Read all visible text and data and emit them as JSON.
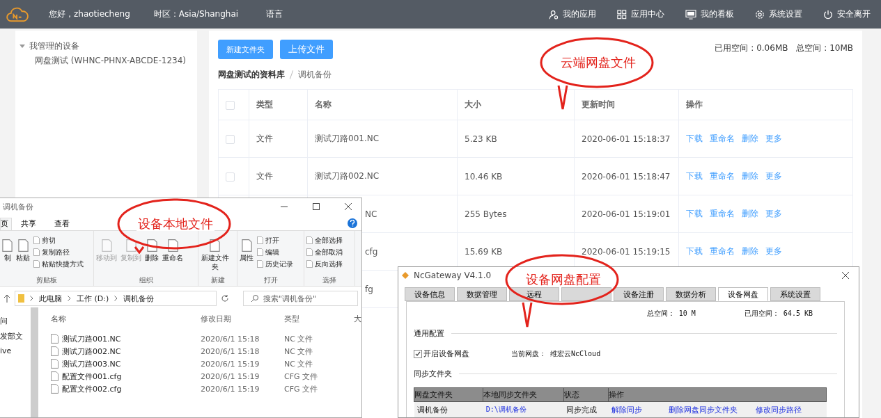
{
  "header": {
    "greeting": "您好，zhaotiecheng",
    "timezone": "时区：Asia/Shanghai",
    "language": "语言",
    "nav": [
      {
        "label": "我的应用",
        "kind": "user"
      },
      {
        "label": "应用中心",
        "kind": "apps"
      },
      {
        "label": "我的看板",
        "kind": "monitor"
      },
      {
        "label": "系统设置",
        "kind": "gear"
      },
      {
        "label": "安全离开",
        "kind": "power"
      }
    ]
  },
  "sidebar": {
    "items": [
      {
        "label": "我管理的设备",
        "expanded": true,
        "children": [
          {
            "label": "网盘测试 (WHNC-PHNX-ABCDE-1234)"
          }
        ]
      }
    ]
  },
  "buttons": [
    "新建文件夹",
    "上传文件"
  ],
  "storage": {
    "used": "已用空间 : 0.06MB",
    "total": "总空间 : 10MB"
  },
  "breadcrumb": [
    "网盘测试的资料库",
    "调机备份"
  ],
  "table": {
    "header_checked": false,
    "columns": [
      "类型",
      "名称",
      "大小",
      "更新时间",
      "操作"
    ],
    "rows": [
      {
        "checked": false,
        "type": "文件",
        "name": "测试刀路001.NC",
        "size": "5.23 KB",
        "time": "2020-06-01 15:18:37",
        "actions": [
          "下载",
          "重命名",
          "删除",
          "更多"
        ]
      },
      {
        "checked": false,
        "type": "文件",
        "name": "测试刀路002.NC",
        "size": "10.46 KB",
        "time": "2020-06-01 15:18:47",
        "actions": [
          "下载",
          "重命名",
          "删除",
          "更多"
        ]
      },
      {
        "name": "NC",
        "size": "255 Bytes",
        "time": "2020-06-01 15:19:01",
        "actions": [
          "下载",
          "重命名",
          "删除",
          "更多"
        ]
      },
      {
        "name": "cfg",
        "size": "15.69 KB",
        "time": "2020-06-01 15:19:15",
        "actions": [
          "下载",
          "重命名",
          "删除",
          "更多"
        ]
      },
      {
        "name": "fg"
      }
    ]
  },
  "explorer": {
    "title": "调机备份",
    "tabs": [
      {
        "label": "页",
        "selected": true
      },
      {
        "label": "共享",
        "selected": false
      },
      {
        "label": "查看",
        "selected": false
      }
    ],
    "groups": [
      {
        "label": "剪贴板",
        "items": [
          {
            "kind": "large",
            "label": "制",
            "disabled": false
          },
          {
            "kind": "large",
            "label": "粘贴",
            "disabled": false
          },
          {
            "kind": "small",
            "label": "剪切"
          },
          {
            "kind": "small",
            "label": "复制路径"
          },
          {
            "kind": "small",
            "label": "粘贴快捷方式"
          }
        ]
      },
      {
        "label": "组织",
        "items": [
          {
            "kind": "large",
            "label": "移动到",
            "disabled": true
          },
          {
            "kind": "large",
            "label": "复制到",
            "disabled": true
          },
          {
            "kind": "large",
            "label": "删除",
            "disabled": false
          },
          {
            "kind": "large",
            "label": "重命名",
            "disabled": false
          }
        ]
      },
      {
        "label": "新建",
        "items": [
          {
            "kind": "large",
            "label": "新建文件夹",
            "disabled": false
          }
        ]
      },
      {
        "label": "打开",
        "items": [
          {
            "kind": "large",
            "label": "属性",
            "disabled": false
          },
          {
            "kind": "small",
            "label": "打开"
          },
          {
            "kind": "small",
            "label": "编辑"
          },
          {
            "kind": "small",
            "label": "历史记录"
          }
        ]
      },
      {
        "label": "选择",
        "items": [
          {
            "kind": "small",
            "label": "全部选择"
          },
          {
            "kind": "small",
            "label": "全部取消"
          },
          {
            "kind": "small",
            "label": "反向选择"
          }
        ]
      }
    ],
    "address": [
      "此电脑",
      "工作 (D:)",
      "调机备份"
    ],
    "search": {
      "placeholder": "搜索\"调机备份\""
    },
    "nav": [
      "问",
      "发部文",
      "ive"
    ],
    "columns": [
      "名称",
      "修改日期",
      "类型",
      "大"
    ],
    "files": [
      {
        "name": "测试刀路001.NC",
        "date": "2020/6/1 15:18",
        "type": "NC 文件"
      },
      {
        "name": "测试刀路002.NC",
        "date": "2020/6/1 15:18",
        "type": "NC 文件"
      },
      {
        "name": "测试刀路003.NC",
        "date": "2020/6/1 15:19",
        "type": "NC 文件"
      },
      {
        "name": "配置文件001.cfg",
        "date": "2020/6/1 15:19",
        "type": "CFG 文件"
      },
      {
        "name": "配置文件002.cfg",
        "date": "2020/6/1 15:19",
        "type": "CFG 文件"
      }
    ]
  },
  "gateway": {
    "title": "NcGateway V4.1.0",
    "tabs": [
      {
        "label": "设备信息",
        "selected": false
      },
      {
        "label": "数据管理",
        "selected": false
      },
      {
        "label": "远程",
        "selected": false
      },
      {
        "selected": false
      },
      {
        "label": "设备注册",
        "selected": false
      },
      {
        "label": "数据分析",
        "selected": false
      },
      {
        "label": "设备网盘",
        "selected": true
      },
      {
        "label": "系统设置",
        "selected": false
      }
    ],
    "total": "总空间： 10 M",
    "used": "已用空间： 64.5 KB",
    "general": "通用配置",
    "enable": {
      "label": "开启设备网盘",
      "checked": true
    },
    "current": "当前网盘： 维宏云NcCloud",
    "sync_title": "同步文件夹",
    "columns": [
      "网盘文件夹",
      "本地同步文件夹",
      "状态",
      "操作"
    ],
    "rows": [
      {
        "folder": "调机备份",
        "local": "D:\\调机备份",
        "status": "同步完成",
        "actions": [
          "解除同步",
          "删除网盘同步文件夹",
          "修改同步路径"
        ]
      }
    ]
  },
  "callouts": [
    "云端网盘文件",
    "设备本地文件",
    "设备网盘配置"
  ]
}
